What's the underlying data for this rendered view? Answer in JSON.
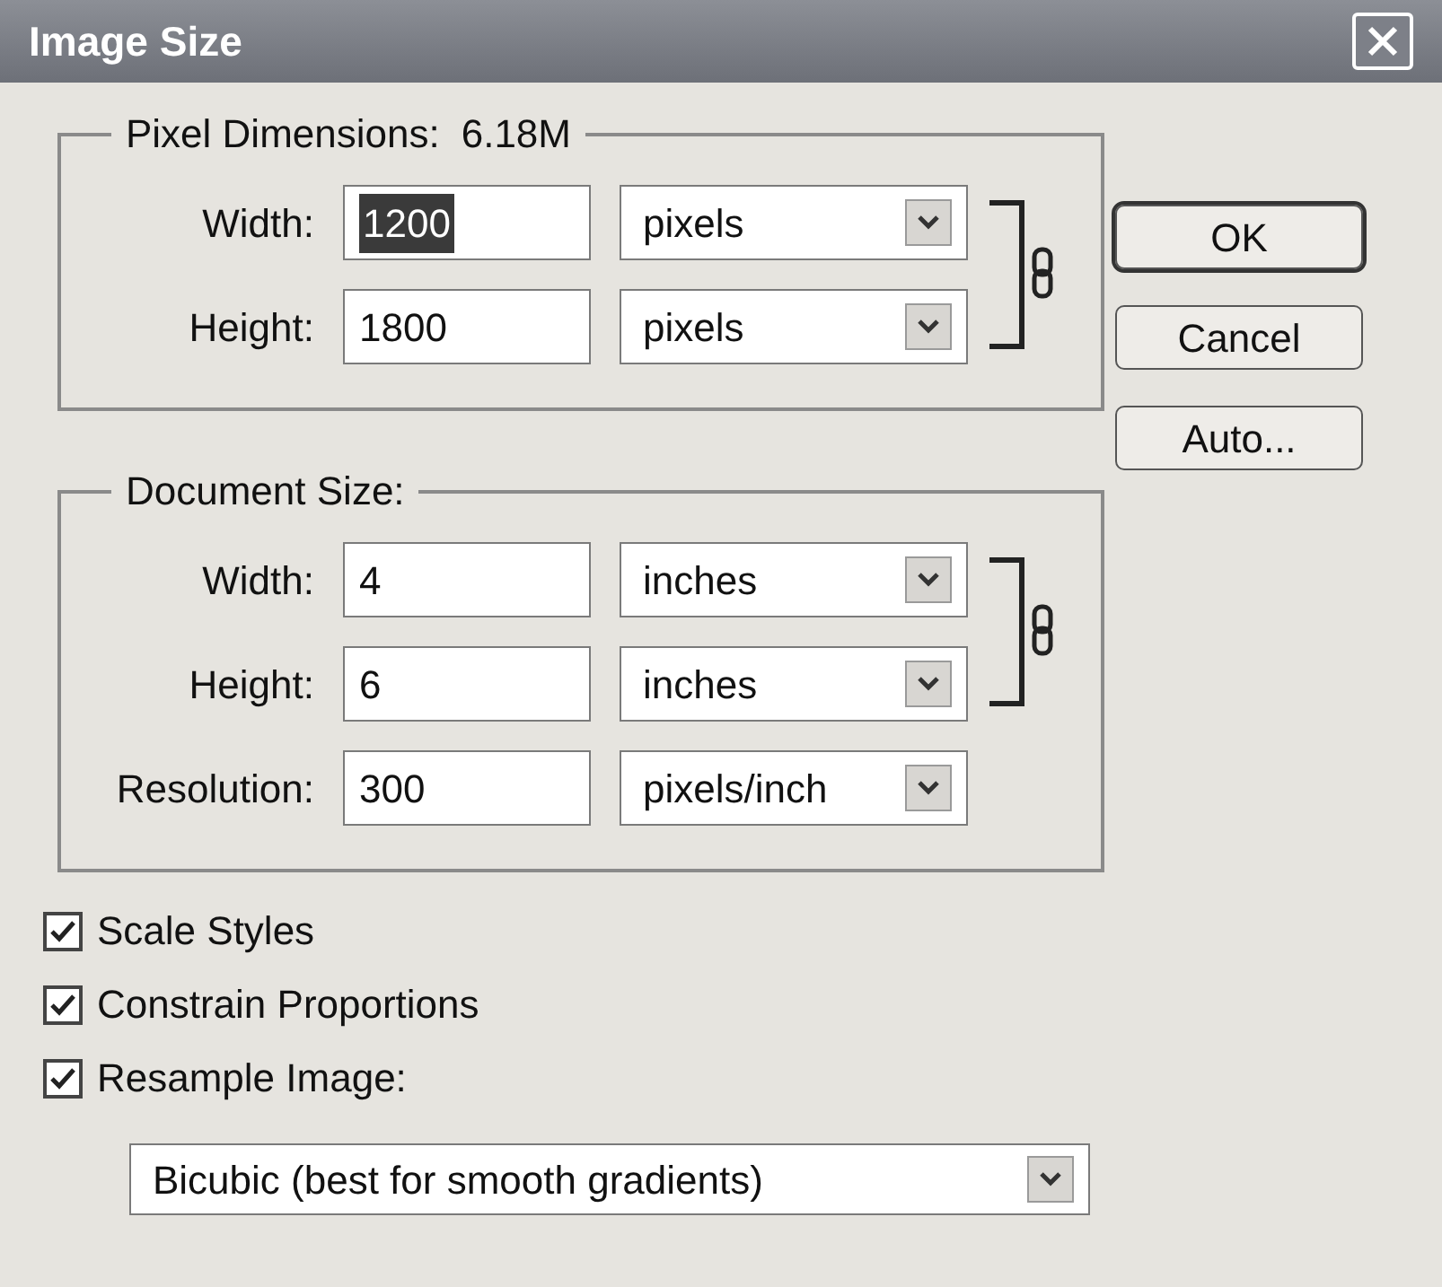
{
  "window": {
    "title": "Image Size"
  },
  "pixel_dimensions": {
    "title": "Pixel Dimensions:",
    "value": "6.18M",
    "fields": [
      {
        "label": "Width:",
        "value": "1200",
        "unit": "pixels",
        "selected": true
      },
      {
        "label": "Height:",
        "value": "1800",
        "unit": "pixels",
        "selected": false
      }
    ]
  },
  "document_size": {
    "title": "Document Size:",
    "fields": [
      {
        "label": "Width:",
        "value": "4",
        "unit": "inches",
        "selected": false
      },
      {
        "label": "Height:",
        "value": "6",
        "unit": "inches",
        "selected": false
      },
      {
        "label": "Resolution:",
        "value": "300",
        "unit": "pixels/inch",
        "selected": false
      }
    ]
  },
  "options": [
    {
      "label": "Scale Styles",
      "checked": true
    },
    {
      "label": "Constrain Proportions",
      "checked": true
    },
    {
      "label": "Resample Image:",
      "checked": true
    }
  ],
  "resample_method": "Bicubic (best for smooth gradients)",
  "buttons": [
    "OK",
    "Cancel",
    "Auto..."
  ]
}
